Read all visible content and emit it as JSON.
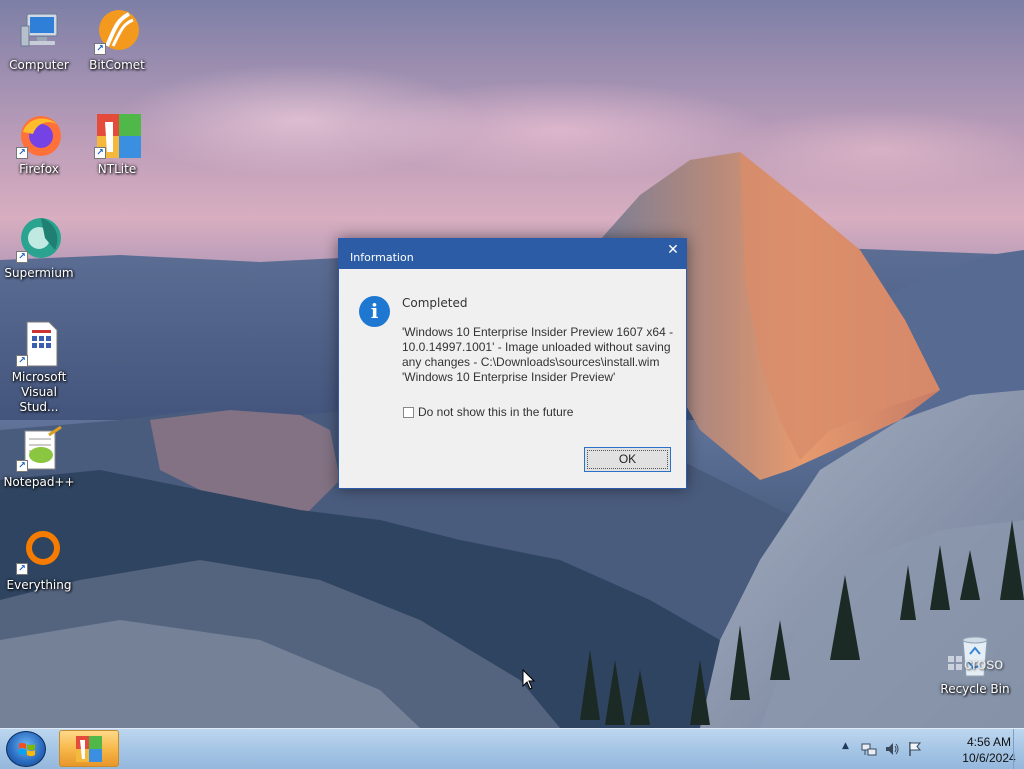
{
  "desktop": {
    "icons": [
      {
        "name": "Computer"
      },
      {
        "name": "BitComet"
      },
      {
        "name": "Firefox"
      },
      {
        "name": "NTLite"
      },
      {
        "name": "Supermium"
      },
      {
        "name": "Microsoft Visual Stud..."
      },
      {
        "name": "Notepad++"
      },
      {
        "name": "Everything"
      },
      {
        "name": "Recycle Bin"
      }
    ],
    "watermark_fragment": "croso"
  },
  "dialog": {
    "title": "Information",
    "close_glyph": "✕",
    "heading": "Completed",
    "message_lines": [
      "'Windows 10 Enterprise Insider Preview 1607 x64 -",
      "10.0.14997.1001' - Image unloaded without saving",
      "any changes - C:\\Downloads\\sources\\install.wim",
      "'Windows 10 Enterprise Insider Preview'"
    ],
    "checkbox_label": "Do not show this in the future",
    "checkbox_checked": false,
    "ok_label": "OK"
  },
  "taskbar": {
    "tray_arrow": "▲",
    "time": "4:56 AM",
    "date": "10/6/2024"
  },
  "colors": {
    "dialog_title": "#2b5ca5",
    "info_icon": "#1e78d2",
    "ok_border": "#2a72c7"
  }
}
